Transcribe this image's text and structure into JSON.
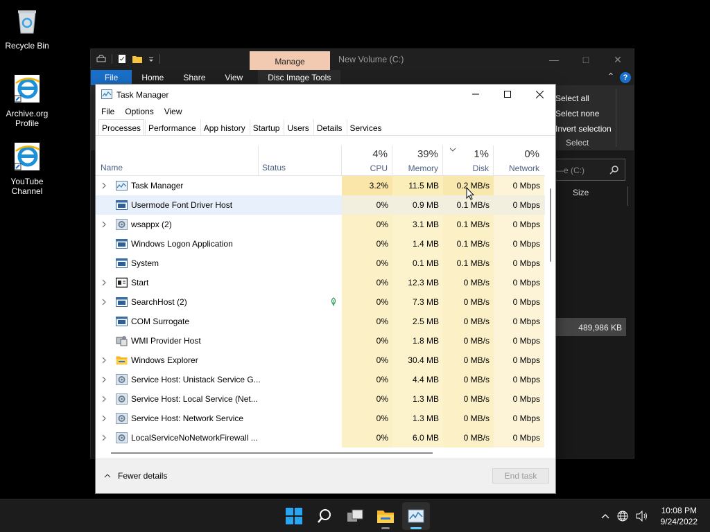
{
  "desktop": {
    "icons": [
      {
        "label": "Recycle Bin"
      },
      {
        "label": "Archive.org Profile"
      },
      {
        "label": "YouTube Channel"
      }
    ]
  },
  "explorer": {
    "title": "New Volume (C:)",
    "contextual_tab": "Manage",
    "ribbon_tabs": [
      "File",
      "Home",
      "Share",
      "View",
      "Disc Image Tools"
    ],
    "select_items": [
      "Select all",
      "Select none",
      "Invert selection"
    ],
    "select_group_label": "Select",
    "search_placeholder": "Search New Volume (C:)",
    "search_visible": "P—e (C:)",
    "column_size": "Size",
    "size_value": "489,986 KB"
  },
  "taskmanager": {
    "title": "Task Manager",
    "menu": [
      "File",
      "Options",
      "View"
    ],
    "tabs": [
      "Processes",
      "Performance",
      "App history",
      "Startup",
      "Users",
      "Details",
      "Services"
    ],
    "active_tab": "Processes",
    "columns": {
      "name": "Name",
      "status": "Status",
      "cpu": {
        "label": "CPU",
        "pct": "4%"
      },
      "memory": {
        "label": "Memory",
        "pct": "39%"
      },
      "disk": {
        "label": "Disk",
        "pct": "1%"
      },
      "network": {
        "label": "Network",
        "pct": "0%"
      }
    },
    "processes": [
      {
        "name": "Task Manager",
        "expandable": true,
        "icon": "taskmanager-icon",
        "cpu": "3.2%",
        "memory": "11.5 MB",
        "disk": "0.2 MB/s",
        "network": "0 Mbps"
      },
      {
        "name": "Usermode Font Driver Host",
        "expandable": false,
        "icon": "app-window-icon",
        "cpu": "0%",
        "memory": "0.9 MB",
        "disk": "0.1 MB/s",
        "network": "0 Mbps",
        "selected": true
      },
      {
        "name": "wsappx (2)",
        "expandable": true,
        "icon": "gear-icon",
        "cpu": "0%",
        "memory": "3.1 MB",
        "disk": "0.1 MB/s",
        "network": "0 Mbps"
      },
      {
        "name": "Windows Logon Application",
        "expandable": false,
        "icon": "app-window-icon",
        "cpu": "0%",
        "memory": "1.4 MB",
        "disk": "0.1 MB/s",
        "network": "0 Mbps"
      },
      {
        "name": "System",
        "expandable": false,
        "icon": "app-window-icon",
        "cpu": "0%",
        "memory": "0.1 MB",
        "disk": "0.1 MB/s",
        "network": "0 Mbps"
      },
      {
        "name": "Start",
        "expandable": true,
        "icon": "start-window-icon",
        "cpu": "0%",
        "memory": "12.3 MB",
        "disk": "0 MB/s",
        "network": "0 Mbps"
      },
      {
        "name": "SearchHost (2)",
        "expandable": true,
        "icon": "app-window-icon",
        "cpu": "0%",
        "memory": "7.3 MB",
        "disk": "0 MB/s",
        "network": "0 Mbps",
        "suspended": true
      },
      {
        "name": "COM Surrogate",
        "expandable": false,
        "icon": "app-window-icon",
        "cpu": "0%",
        "memory": "2.5 MB",
        "disk": "0 MB/s",
        "network": "0 Mbps"
      },
      {
        "name": "WMI Provider Host",
        "expandable": false,
        "icon": "wmi-icon",
        "cpu": "0%",
        "memory": "1.8 MB",
        "disk": "0 MB/s",
        "network": "0 Mbps"
      },
      {
        "name": "Windows Explorer",
        "expandable": true,
        "icon": "folder-icon",
        "cpu": "0%",
        "memory": "30.4 MB",
        "disk": "0 MB/s",
        "network": "0 Mbps"
      },
      {
        "name": "Service Host: Unistack Service G...",
        "expandable": true,
        "icon": "gear-icon",
        "cpu": "0%",
        "memory": "4.4 MB",
        "disk": "0 MB/s",
        "network": "0 Mbps"
      },
      {
        "name": "Service Host: Local Service (Net...",
        "expandable": true,
        "icon": "gear-icon",
        "cpu": "0%",
        "memory": "1.3 MB",
        "disk": "0 MB/s",
        "network": "0 Mbps"
      },
      {
        "name": "Service Host: Network Service",
        "expandable": true,
        "icon": "gear-icon",
        "cpu": "0%",
        "memory": "1.3 MB",
        "disk": "0 MB/s",
        "network": "0 Mbps"
      },
      {
        "name": "LocalServiceNoNetworkFirewall ...",
        "expandable": true,
        "icon": "gear-icon",
        "cpu": "0%",
        "memory": "6.0 MB",
        "disk": "0 MB/s",
        "network": "0 Mbps"
      }
    ],
    "fewer_details": "Fewer details",
    "end_task": "End task"
  },
  "taskbar": {
    "time": "10:08 PM",
    "date": "9/24/2022"
  },
  "colors": {
    "accent": "#1a6fc9",
    "manage_tab": "#f2c9b1",
    "heat_cpu": "#fbf0c6",
    "selection": "#e8f1fb"
  }
}
